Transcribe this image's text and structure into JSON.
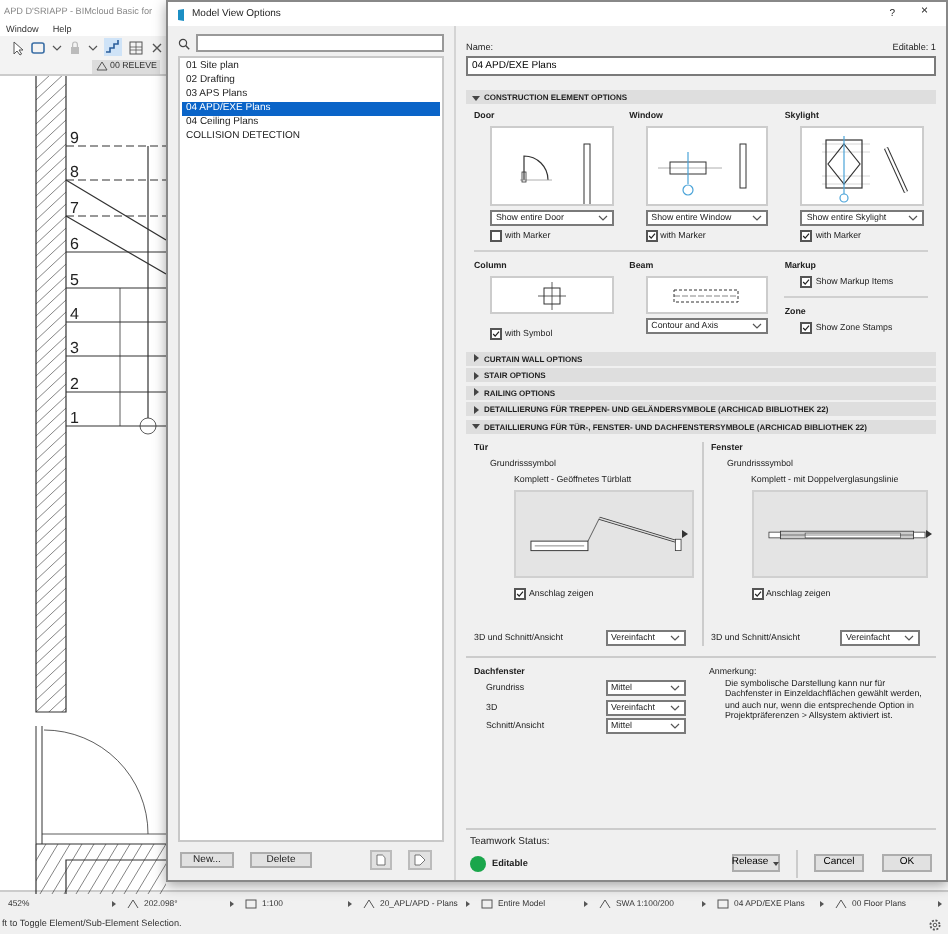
{
  "app": {
    "title": "APD D'SRIAPP - BIMcloud Basic for",
    "menu": [
      "Window",
      "Help"
    ],
    "view_tab": "00 RELEVE",
    "stair_numbers": [
      "9",
      "8",
      "7",
      "6",
      "5",
      "4",
      "3",
      "2",
      "1"
    ]
  },
  "dialog": {
    "title": "Model View Options",
    "help": "?",
    "close": "×",
    "views": [
      {
        "label": "01 Site plan",
        "selected": false
      },
      {
        "label": "02 Drafting",
        "selected": false
      },
      {
        "label": "03 APS Plans",
        "selected": false
      },
      {
        "label": "04 APD/EXE Plans",
        "selected": true
      },
      {
        "label": "04 Ceiling Plans",
        "selected": false
      },
      {
        "label": "COLLISION DETECTION",
        "selected": false
      }
    ],
    "list_buttons": [
      "New...",
      "Delete"
    ],
    "name_label": "Name:",
    "name_value": "04 APD/EXE Plans",
    "editable_label": "Editable: 1",
    "construction": {
      "title": "CONSTRUCTION ELEMENT OPTIONS",
      "expanded": true,
      "elements": [
        {
          "kind": "door",
          "label": "Door",
          "display": "Show entire Door",
          "option": "with Marker",
          "checked": false
        },
        {
          "kind": "window",
          "label": "Window",
          "display": "Show entire Window",
          "option": "with Marker",
          "checked": true
        },
        {
          "kind": "skylight",
          "label": "Skylight",
          "display": "Show entire Skylight",
          "option": "with Marker",
          "checked": true
        }
      ],
      "column": {
        "label": "Column",
        "option": "with Symbol",
        "checked": true
      },
      "beam": {
        "label": "Beam",
        "display": "Contour and Axis"
      },
      "markup": {
        "label": "Markup",
        "option": "Show Markup Items",
        "checked": true
      },
      "zone": {
        "label": "Zone",
        "option": "Show Zone Stamps",
        "checked": true
      }
    },
    "sections": [
      {
        "title": "CURTAIN WALL OPTIONS",
        "expanded": false
      },
      {
        "title": "STAIR OPTIONS",
        "expanded": false
      },
      {
        "title": "RAILING OPTIONS",
        "expanded": false
      },
      {
        "title": "DETAILLIERUNG FÜR TREPPEN- UND GELÄNDERSYMBOLE (ARCHICAD BIBLIOTHEK 22)",
        "expanded": false
      }
    ],
    "details": {
      "title": "DETAILLIERUNG FÜR TÜR-, FENSTER- UND DACHFENSTERSYMBOLE (ARCHICAD BIBLIOTHEK 22)",
      "expanded": true,
      "panels": [
        {
          "kind": "door",
          "label": "Tür",
          "sub_label": "Grundrisssymbol",
          "preview_label": "Komplett - Geöffnetes Türblatt",
          "option": "Anschlag zeigen",
          "checked": true,
          "row_label": "3D und Schnitt/Ansicht",
          "row_value": "Vereinfacht"
        },
        {
          "kind": "window",
          "label": "Fenster",
          "sub_label": "Grundrisssymbol",
          "preview_label": "Komplett - mit Doppelverglasungslinie",
          "option": "Anschlag zeigen",
          "checked": true,
          "row_label": "3D und Schnitt/Ansicht",
          "row_value": "Vereinfacht"
        }
      ],
      "skylight": {
        "label": "Dachfenster",
        "rows": [
          {
            "label": "Grundriss",
            "value": "Mittel"
          },
          {
            "label": "3D",
            "value": "Vereinfacht"
          },
          {
            "label": "Schnitt/Ansicht",
            "value": "Mittel"
          }
        ]
      },
      "note": {
        "label": "Anmerkung:",
        "text": "Die symbolische Darstellung kann nur für Dachfenster in Einzeldachflächen gewählt werden, und auch nur, wenn die entsprechende Option in Projektpräferenzen > Allsystem aktiviert ist."
      }
    },
    "teamwork": {
      "label": "Teamwork Status:",
      "status": "Editable",
      "color": "#1aa64b"
    },
    "buttons": [
      {
        "label": "Release",
        "kind": "split"
      },
      {
        "label": "Cancel",
        "kind": "plain"
      },
      {
        "label": "OK",
        "kind": "plain"
      }
    ]
  },
  "status_bar": [
    "452%",
    "202.098°",
    "1:100",
    "20_APL/APD - Plans",
    "Entire Model",
    "SWA 1:100/200",
    "04 APD/EXE Plans",
    "00 Floor Plans"
  ],
  "hint": "ft to Toggle Element/Sub-Element Selection."
}
